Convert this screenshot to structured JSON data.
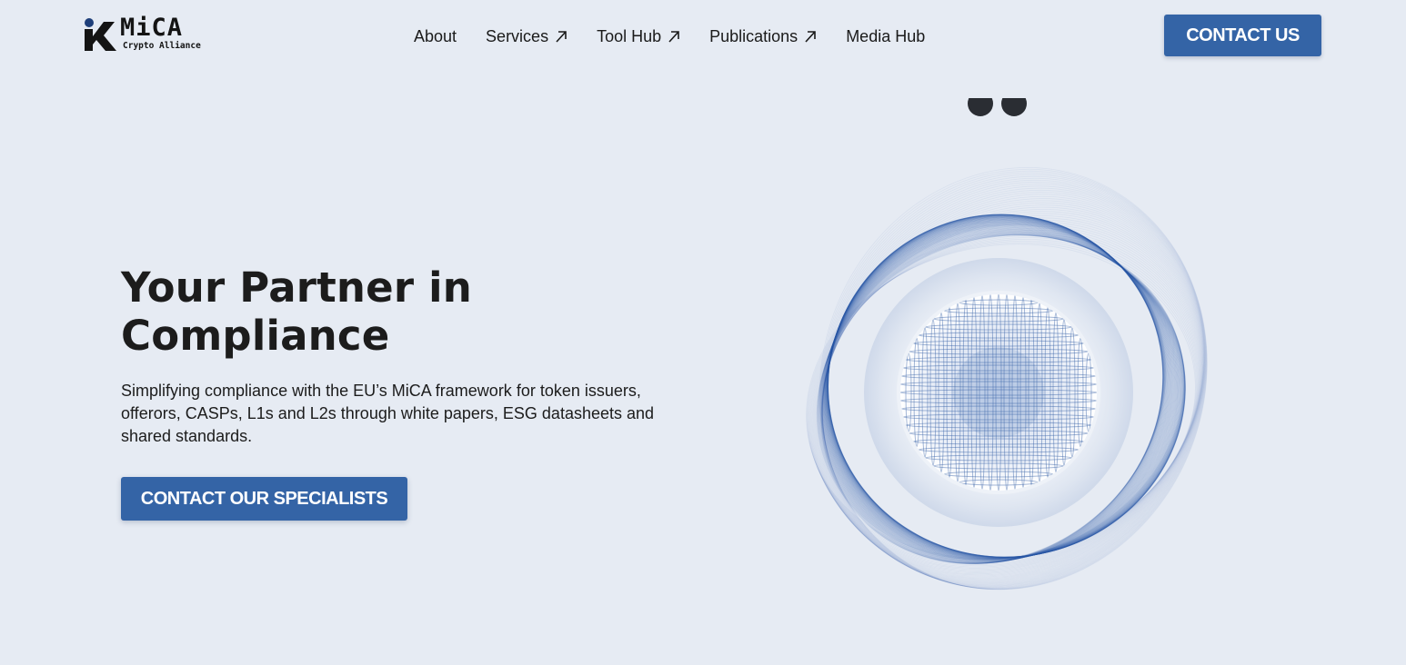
{
  "header": {
    "logo": {
      "wordmark": "MiCA",
      "tagline": "Crypto Alliance"
    },
    "nav": [
      {
        "label": "About",
        "has_external_arrow": false
      },
      {
        "label": "Services",
        "has_external_arrow": true
      },
      {
        "label": "Tool Hub",
        "has_external_arrow": true
      },
      {
        "label": "Publications",
        "has_external_arrow": true
      },
      {
        "label": "Media Hub",
        "has_external_arrow": false
      }
    ],
    "contact_button": "CONTACT US"
  },
  "hero": {
    "title": "Your Partner in Compliance",
    "description": "Simplifying compliance with the EU’s MiCA framework for token issuers, offerors, CASPs, L1s and L2s through white papers, ESG datasheets and shared standards.",
    "cta_label": "CONTACT OUR SPECIALISTS"
  },
  "colors": {
    "background": "#e6ebf3",
    "primary_button": "#3464a6",
    "text": "#1c1c1c",
    "graphic_blue": "#2c5aa8"
  },
  "icons": {
    "nav_arrow": "arrow-up-right-icon",
    "logo_mark": "mica-logo-icon"
  }
}
